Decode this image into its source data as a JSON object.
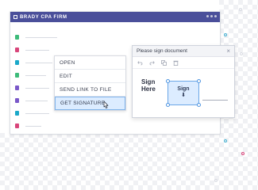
{
  "app": {
    "title": "BRADY CPA FIRM"
  },
  "files": [
    {
      "color": "#3dbb7a"
    },
    {
      "color": "#d8457a"
    },
    {
      "color": "#1aa8c9"
    },
    {
      "color": "#3dbb7a"
    },
    {
      "color": "#7a58c9"
    },
    {
      "color": "#7a58c9"
    },
    {
      "color": "#1aa8c9"
    },
    {
      "color": "#d8457a"
    }
  ],
  "context_menu": {
    "items": [
      {
        "label": "OPEN"
      },
      {
        "label": "EDIT"
      },
      {
        "label": "SEND LINK TO FILE"
      },
      {
        "label": "GET SIGNATURE"
      }
    ],
    "selected": "GET SIGNATURE"
  },
  "dialog": {
    "title": "Please sign document",
    "close_symbol": "×",
    "tools": [
      "undo-icon",
      "redo-icon",
      "copy-icon",
      "delete-icon"
    ],
    "sign_here_line1": "Sign",
    "sign_here_line2": "Here",
    "sign_field_label": "Sign",
    "sign_arrow": "⬇"
  },
  "colors": {
    "titlebar": "#4a4f9a",
    "accent_blue": "#4d94e0",
    "selection_bg": "#dcecff"
  }
}
